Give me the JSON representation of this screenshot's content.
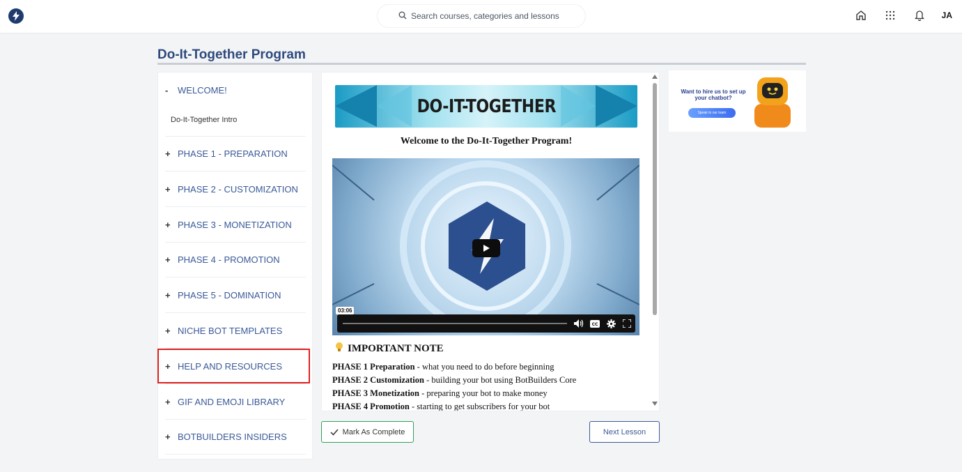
{
  "topbar": {
    "search_placeholder": "Search courses, categories and lessons",
    "user_initials": "JA",
    "icons": [
      "logo-icon",
      "search-icon",
      "home-icon",
      "apps-grid-icon",
      "bell-icon"
    ]
  },
  "page": {
    "title": "Do-It-Together Program"
  },
  "sidebar": {
    "welcome": {
      "sign": "-",
      "label": "WELCOME!",
      "sub_item": "Do-It-Together Intro"
    },
    "items": [
      {
        "sign": "+",
        "label": "PHASE 1 - PREPARATION"
      },
      {
        "sign": "+",
        "label": "PHASE 2 - CUSTOMIZATION"
      },
      {
        "sign": "+",
        "label": "PHASE 3 - MONETIZATION"
      },
      {
        "sign": "+",
        "label": "PHASE 4 - PROMOTION"
      },
      {
        "sign": "+",
        "label": "PHASE 5 - DOMINATION"
      },
      {
        "sign": "+",
        "label": "NICHE BOT TEMPLATES"
      },
      {
        "sign": "+",
        "label": "HELP AND RESOURCES"
      },
      {
        "sign": "+",
        "label": "GIF AND EMOJI LIBRARY"
      },
      {
        "sign": "+",
        "label": "BOTBUILDERS INSIDERS"
      }
    ],
    "highlight_color": "#e02020"
  },
  "lesson": {
    "banner_text": "DO-IT-TOGETHER",
    "welcome_heading": "Welcome to the Do-It-Together Program!",
    "video": {
      "timestamp": "03:06",
      "cc_label": "CC"
    },
    "note_title": "IMPORTANT NOTE",
    "phases": [
      {
        "bold": "PHASE 1 Preparation",
        "text": " - what you need to do before beginning"
      },
      {
        "bold": "PHASE 2 Customization",
        "text": " - building your bot using BotBuilders Core"
      },
      {
        "bold": "PHASE 3 Monetization",
        "text": " - preparing your bot to make money"
      },
      {
        "bold": "PHASE 4 Promotion",
        "text": " - starting to get subscribers for your bot"
      }
    ]
  },
  "actions": {
    "mark_complete": "Mark As Complete",
    "next_lesson": "Next Lesson"
  },
  "ad": {
    "headline": "Want to hire us to set up your chatbot?",
    "button": "Speak to our team"
  },
  "colors": {
    "brand_blue": "#2e4a7d",
    "link_blue": "#3a5998",
    "complete_green": "#2e9e5b"
  }
}
